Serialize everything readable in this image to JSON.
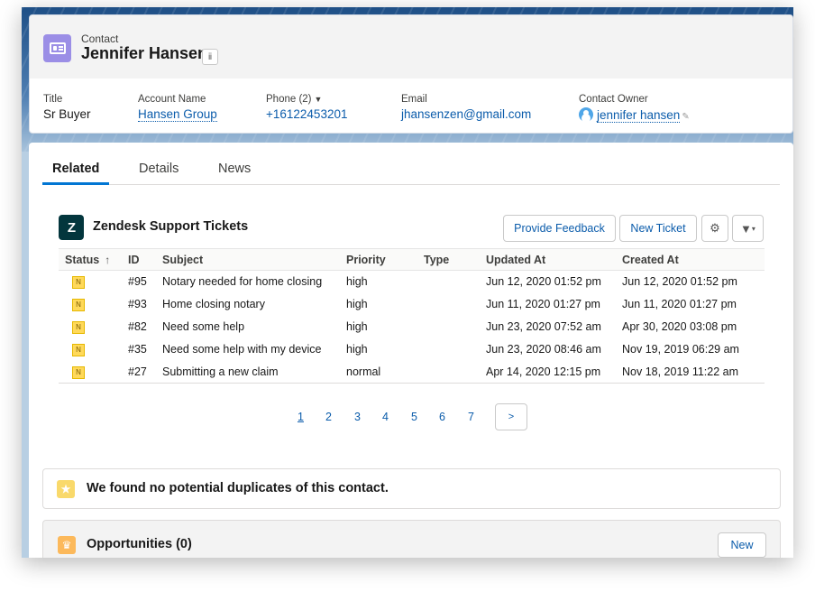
{
  "header": {
    "entity_label": "Contact",
    "record_name": "Jennifer Hansen",
    "hierarchy_icon": "hierarchy-icon",
    "fields": [
      {
        "label": "Title",
        "value": "Sr Buyer"
      },
      {
        "label": "Account Name",
        "value": "Hansen Group"
      },
      {
        "label": "Phone (2)",
        "value": "+16122453201"
      },
      {
        "label": "Email",
        "value": "jhansenzen@gmail.com"
      },
      {
        "label": "Contact Owner",
        "value": "jennifer hansen"
      }
    ]
  },
  "tabs": [
    {
      "label": "Related",
      "active": true
    },
    {
      "label": "Details",
      "active": false
    },
    {
      "label": "News",
      "active": false
    }
  ],
  "zendesk": {
    "logo_text": "Z",
    "title": "Zendesk Support Tickets",
    "feedback_button": "Provide Feedback",
    "new_ticket_button": "New Ticket",
    "settings_icon": "gear-icon",
    "filter_icon": "filter-icon",
    "sort_glyph": "↑",
    "columns": [
      "Status",
      "ID",
      "Subject",
      "Priority",
      "Type",
      "Updated At",
      "Created At"
    ],
    "rows": [
      {
        "status": "N",
        "id": "#95",
        "subject": "Notary needed for home closing",
        "priority": "high",
        "type": "",
        "updated": "Jun 12, 2020 01:52 pm",
        "created": "Jun 12, 2020 01:52 pm"
      },
      {
        "status": "N",
        "id": "#93",
        "subject": "Home closing notary",
        "priority": "high",
        "type": "",
        "updated": "Jun 11, 2020 01:27 pm",
        "created": "Jun 11, 2020 01:27 pm"
      },
      {
        "status": "N",
        "id": "#82",
        "subject": "Need some help",
        "priority": "high",
        "type": "",
        "updated": "Jun 23, 2020 07:52 am",
        "created": "Apr 30, 2020 03:08 pm"
      },
      {
        "status": "N",
        "id": "#35",
        "subject": "Need some help with my device",
        "priority": "high",
        "type": "",
        "updated": "Jun 23, 2020 08:46 am",
        "created": "Nov 19, 2019 06:29 am"
      },
      {
        "status": "N",
        "id": "#27",
        "subject": "Submitting a new claim",
        "priority": "normal",
        "type": "",
        "updated": "Apr 14, 2020 12:15 pm",
        "created": "Nov 18, 2019 11:22 am"
      }
    ],
    "pages": [
      "1",
      "2",
      "3",
      "4",
      "5",
      "6",
      "7"
    ],
    "current_page": "1",
    "next_label": ">"
  },
  "duplicates": {
    "text": "We found no potential duplicates of this contact."
  },
  "opportunities": {
    "title": "Opportunities (0)",
    "new_button": "New"
  },
  "colors": {
    "accent": "#0176d3",
    "link": "#0b5cab",
    "contact_icon": "#9b8ee6",
    "zendesk": "#03363d",
    "status_new": "#ffd95a"
  }
}
